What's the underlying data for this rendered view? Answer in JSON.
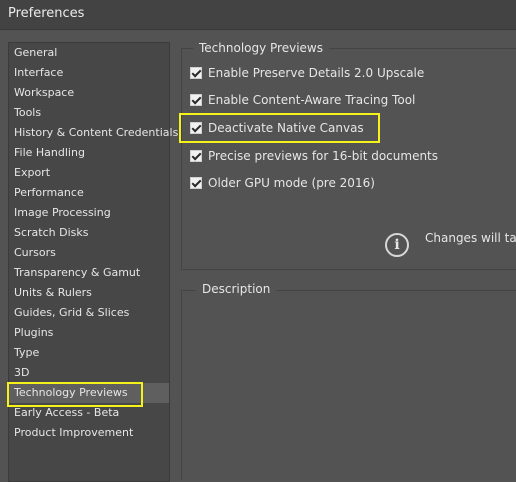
{
  "window": {
    "title": "Preferences"
  },
  "sidebar": {
    "items": [
      {
        "label": "General"
      },
      {
        "label": "Interface"
      },
      {
        "label": "Workspace"
      },
      {
        "label": "Tools"
      },
      {
        "label": "History & Content Credentials"
      },
      {
        "label": "File Handling"
      },
      {
        "label": "Export"
      },
      {
        "label": "Performance"
      },
      {
        "label": "Image Processing"
      },
      {
        "label": "Scratch Disks"
      },
      {
        "label": "Cursors"
      },
      {
        "label": "Transparency & Gamut"
      },
      {
        "label": "Units & Rulers"
      },
      {
        "label": "Guides, Grid & Slices"
      },
      {
        "label": "Plugins"
      },
      {
        "label": "Type"
      },
      {
        "label": "3D"
      },
      {
        "label": "Technology Previews",
        "selected": true
      },
      {
        "label": "Early Access - Beta"
      },
      {
        "label": "Product Improvement"
      }
    ]
  },
  "tech_previews": {
    "heading": "Technology Previews",
    "options": [
      {
        "label": "Enable Preserve Details 2.0 Upscale",
        "checked": true
      },
      {
        "label": "Enable Content-Aware Tracing Tool",
        "checked": true
      },
      {
        "label": "Deactivate Native Canvas",
        "checked": true
      },
      {
        "label": "Precise previews for 16-bit documents",
        "checked": true
      },
      {
        "label": "Older GPU mode (pre 2016)",
        "checked": true
      }
    ],
    "info_text": "Changes will tak"
  },
  "description": {
    "heading": "Description"
  },
  "colors": {
    "highlight": "#f5f21b",
    "background": "#535353"
  },
  "icons": {
    "info": "info-circle-icon",
    "check": "check-icon"
  }
}
